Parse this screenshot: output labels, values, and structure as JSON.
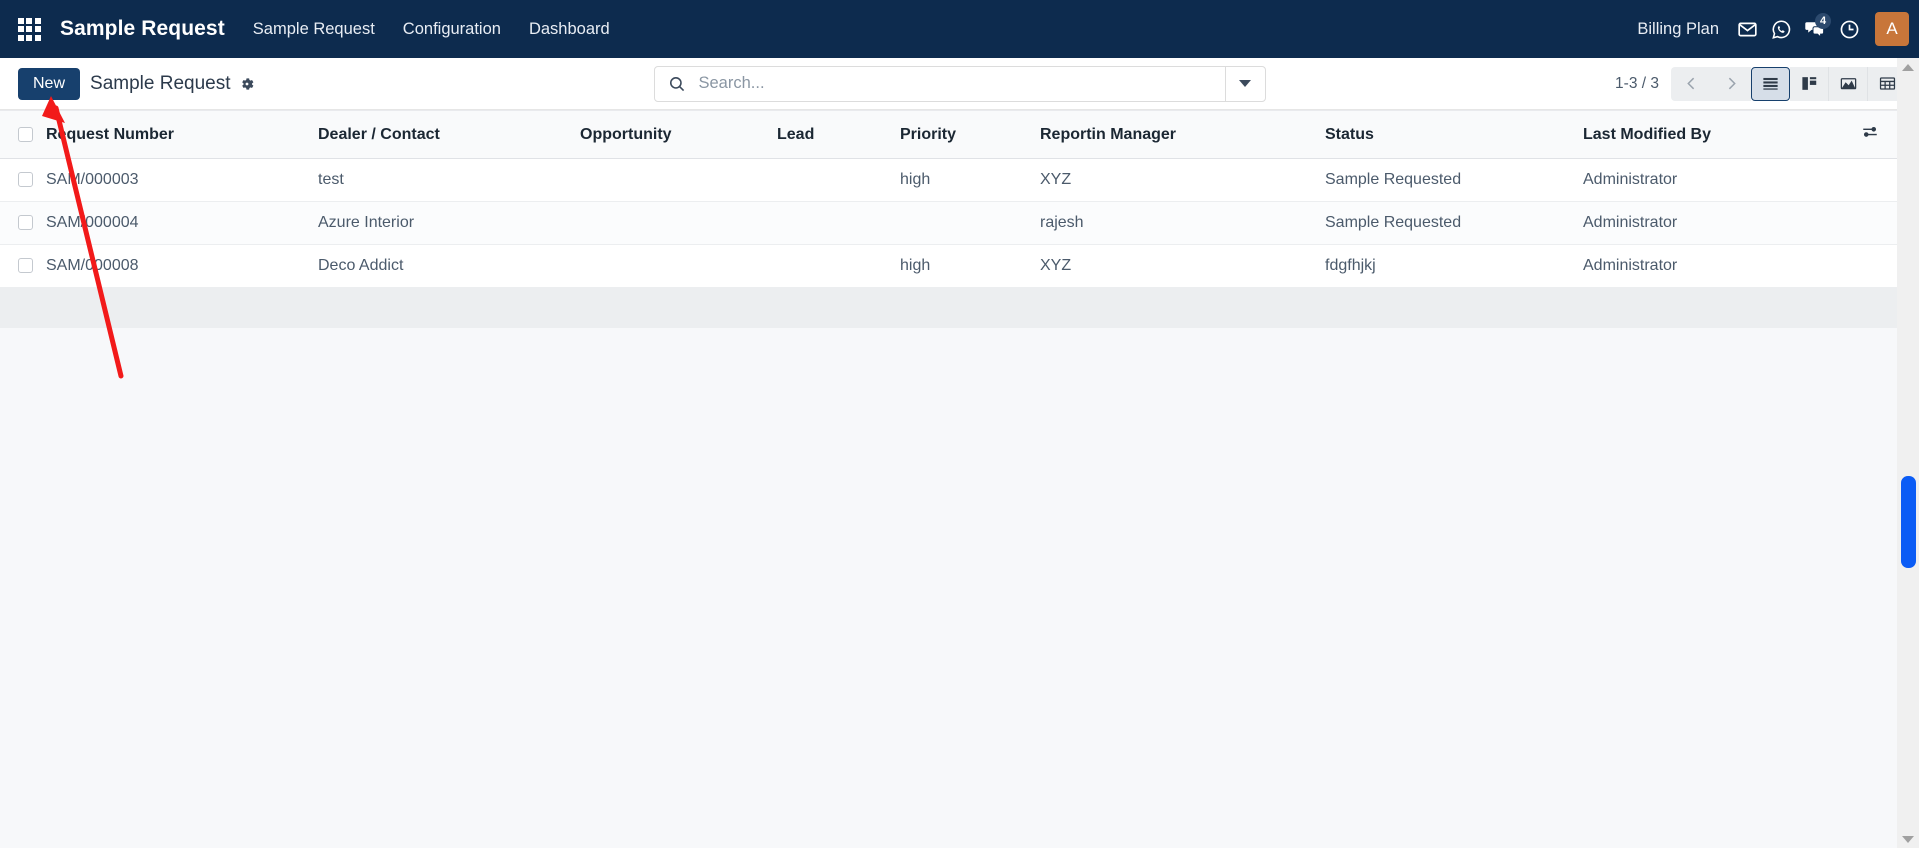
{
  "navbar": {
    "apps_icon": "apps-grid-icon",
    "brand": "Sample Request",
    "menu": [
      {
        "label": "Sample Request"
      },
      {
        "label": "Configuration"
      },
      {
        "label": "Dashboard"
      }
    ],
    "billing_label": "Billing Plan",
    "icons": [
      {
        "name": "mail-icon"
      },
      {
        "name": "whatsapp-icon"
      },
      {
        "name": "messages-icon",
        "badge": "4"
      },
      {
        "name": "activity-clock-icon"
      }
    ],
    "avatar_initial": "A",
    "avatar_color": "#c8763a",
    "background_color": "#0d2b4e"
  },
  "control_panel": {
    "new_button": "New",
    "breadcrumb": "Sample Request",
    "gear_icon": "gear-icon",
    "search": {
      "placeholder": "Search...",
      "value": "",
      "icon": "search-icon",
      "toggle_icon": "chevron-down-icon"
    },
    "pager": {
      "count": "1-3 / 3",
      "previous_icon": "chevron-left-icon",
      "next_icon": "chevron-right-icon"
    },
    "views": [
      {
        "name": "list-view",
        "icon": "list-icon",
        "active": true
      },
      {
        "name": "kanban-view",
        "icon": "kanban-icon",
        "active": false
      },
      {
        "name": "graph-view",
        "icon": "area-chart-icon",
        "active": false
      },
      {
        "name": "pivot-view",
        "icon": "pivot-table-icon",
        "active": false
      }
    ]
  },
  "list": {
    "select_all_checkbox": "select-all-checkbox",
    "optional_columns_icon": "column-settings-icon",
    "columns": [
      "Request Number",
      "Dealer / Contact",
      "Opportunity",
      "Lead",
      "Priority",
      "Reportin Manager",
      "Status",
      "Last Modified By"
    ],
    "rows": [
      {
        "request_number": "SAM/000003",
        "dealer_contact": "test",
        "opportunity": "",
        "lead": "",
        "priority": "high",
        "reporting_manager": "XYZ",
        "status": "Sample Requested",
        "last_modified_by": "Administrator"
      },
      {
        "request_number": "SAM/000004",
        "dealer_contact": "Azure Interior",
        "opportunity": "",
        "lead": "",
        "priority": "",
        "reporting_manager": "rajesh",
        "status": "Sample Requested",
        "last_modified_by": "Administrator"
      },
      {
        "request_number": "SAM/000008",
        "dealer_contact": "Deco Addict",
        "opportunity": "",
        "lead": "",
        "priority": "high",
        "reporting_manager": "XYZ",
        "status": "fdgfhjkj",
        "last_modified_by": "Administrator"
      }
    ]
  },
  "annotation": {
    "arrow_color": "#f21a1a",
    "arrow_description": "red arrow pointing at the New button"
  },
  "scrollbar": {
    "thumb_color": "#0b5cf5",
    "up_arrow": "scroll-up-arrow",
    "down_arrow": "scroll-down-arrow"
  }
}
